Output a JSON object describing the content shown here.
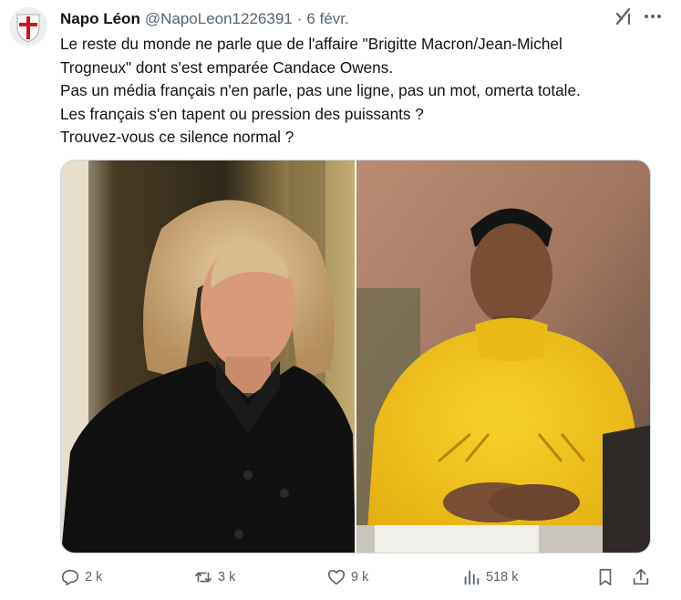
{
  "author": {
    "display_name": "Napo Léon",
    "handle": "@NapoLeon1226391",
    "separator": "·",
    "date": "6 févr.",
    "avatar_icon": "templar-shield-avatar"
  },
  "header_icons": [
    "grok-icon",
    "more-options-icon"
  ],
  "tweet": {
    "text": "Le reste du monde ne parle que de l'affaire \"Brigitte Macron/Jean-Michel\nTrogneux\" dont s'est emparée Candace Owens.\nPas un média français n'en parle, pas une ligne, pas un mot, omerta totale.\nLes français s'en tapent ou pression des puissants ?\nTrouvez-vous ce silence normal ?"
  },
  "media": {
    "count": 2,
    "items": [
      "photo-woman-blonde-black-coat",
      "photo-woman-yellow-sweater"
    ]
  },
  "actions": {
    "replies": "2 k",
    "retweets": "3 k",
    "likes": "9 k",
    "views": "518 k"
  },
  "colors": {
    "text": "#0f1419",
    "secondary": "#536471",
    "border": "#cfd9de",
    "cross_red": "#c8161d"
  }
}
